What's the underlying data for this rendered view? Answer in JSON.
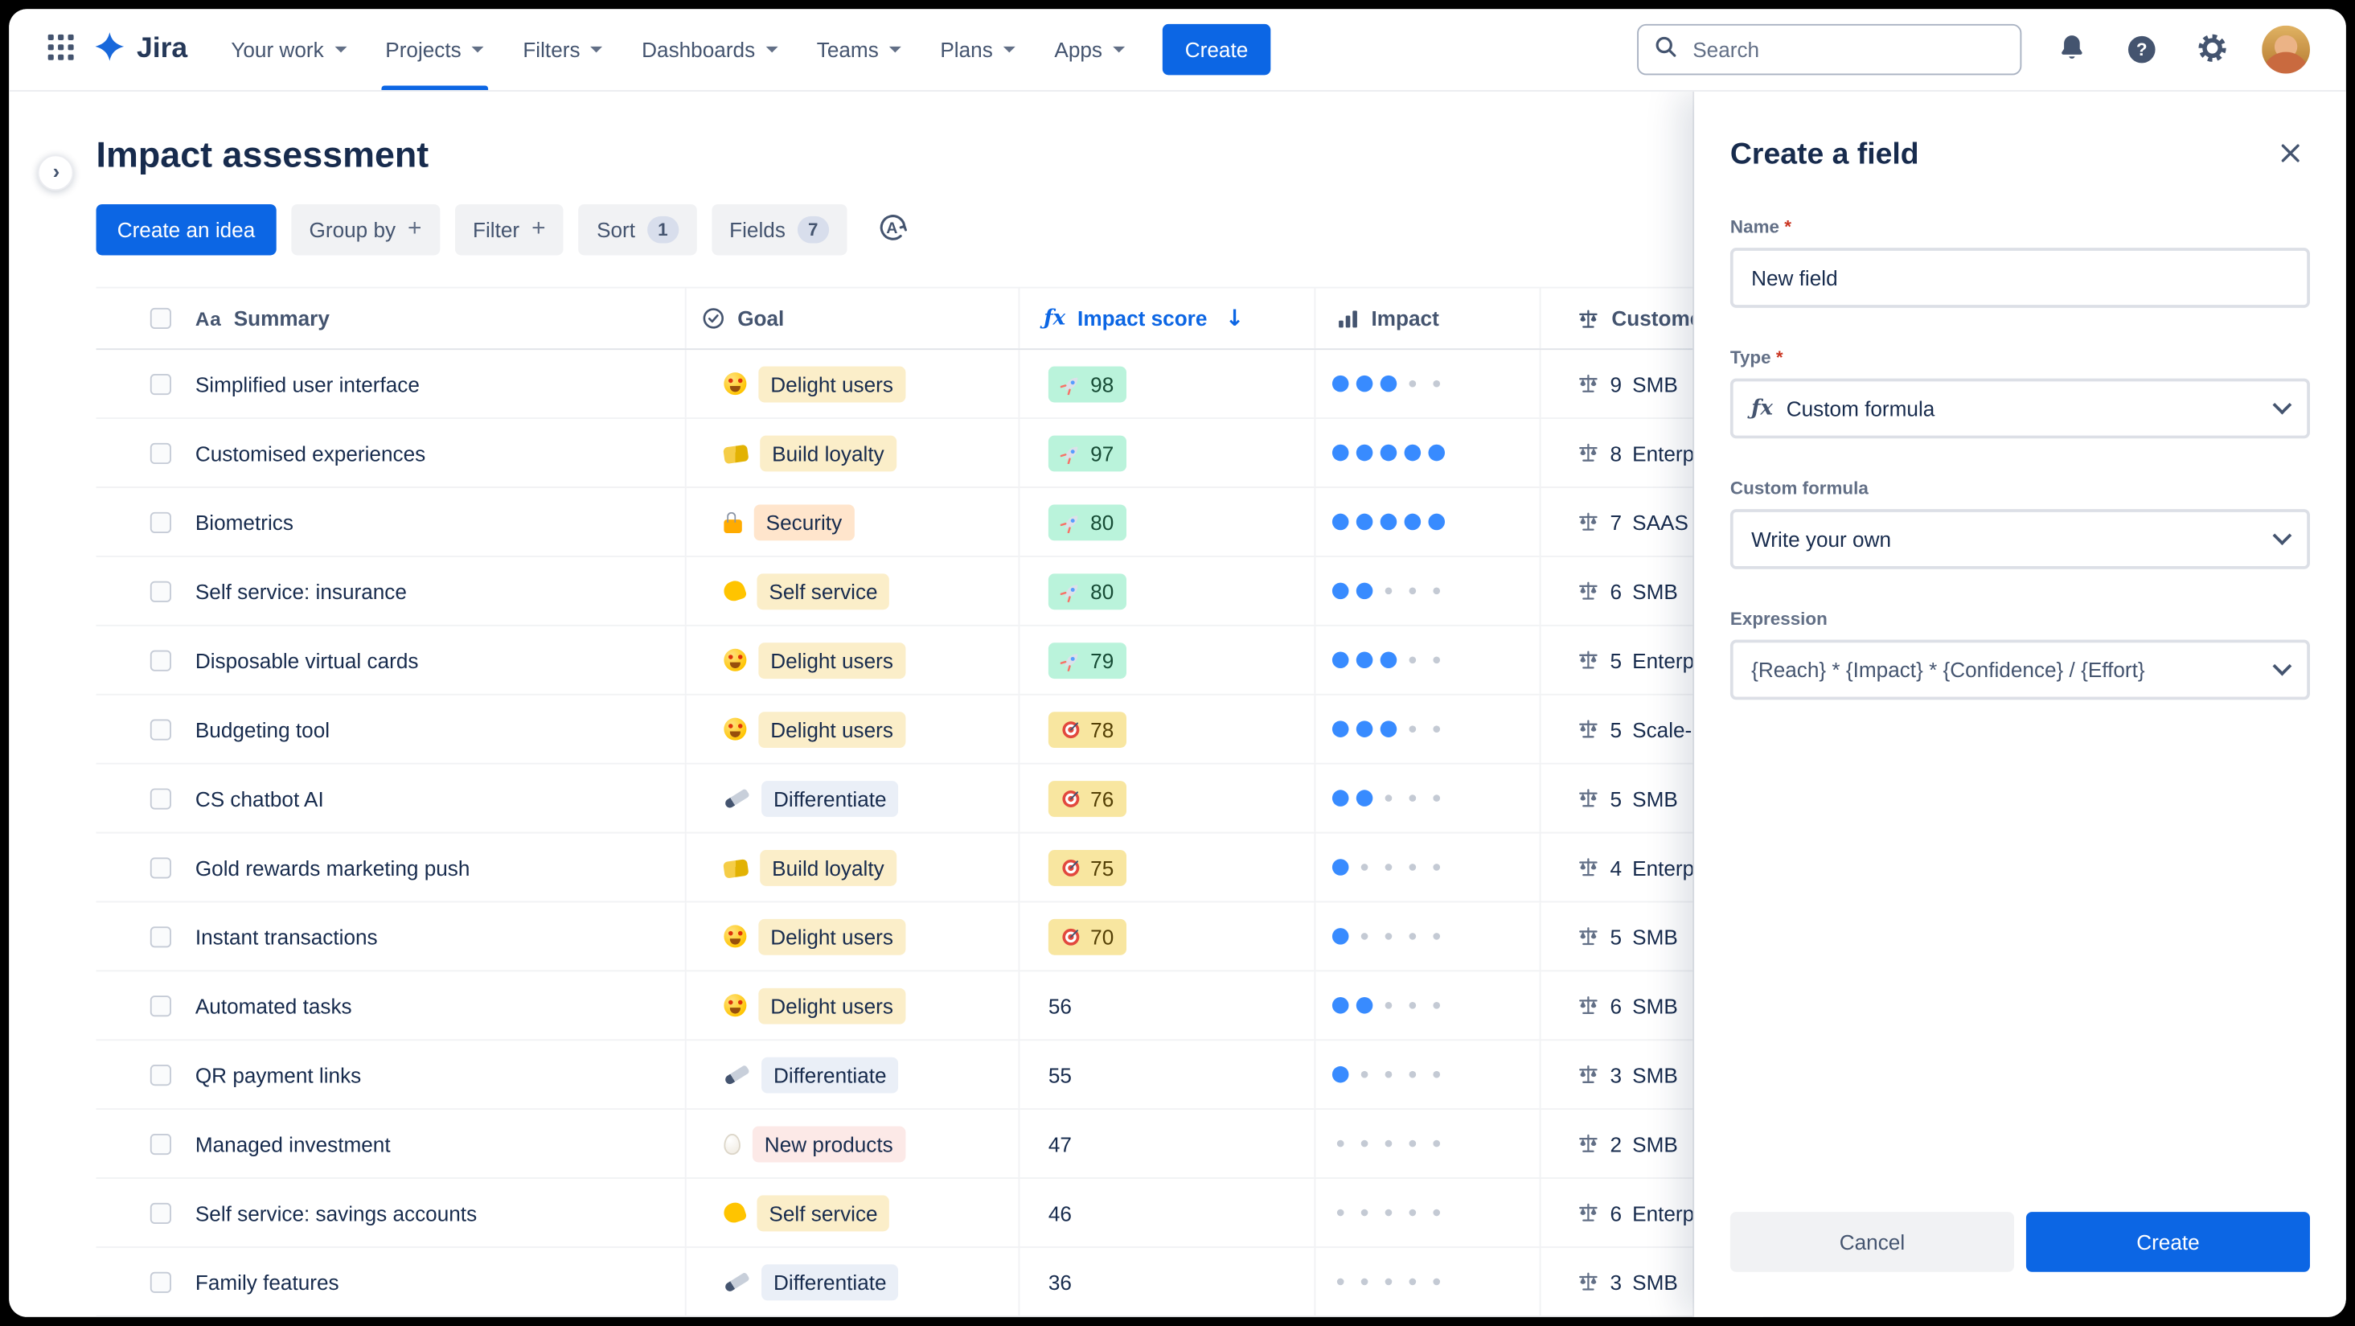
{
  "topnav": {
    "logo": "Jira",
    "items": [
      {
        "label": "Your work",
        "active": false
      },
      {
        "label": "Projects",
        "active": true
      },
      {
        "label": "Filters",
        "active": false
      },
      {
        "label": "Dashboards",
        "active": false
      },
      {
        "label": "Teams",
        "active": false
      },
      {
        "label": "Plans",
        "active": false
      },
      {
        "label": "Apps",
        "active": false
      }
    ],
    "create_button": "Create",
    "search": {
      "placeholder": "Search"
    }
  },
  "page": {
    "title": "Impact assessment"
  },
  "toolbar": {
    "create_idea_button": "Create an idea",
    "group_by_button": "Group by",
    "filter_button": "Filter",
    "sort_button": "Sort",
    "sort_badge": "1",
    "fields_button": "Fields",
    "fields_badge": "7"
  },
  "icons": {
    "summary_type": "Aa",
    "formula": "ƒx",
    "sort_desc": "↓",
    "help": "?"
  },
  "table": {
    "columns": [
      {
        "id": "summary",
        "label": "Summary"
      },
      {
        "id": "goal",
        "label": "Goal"
      },
      {
        "id": "impact_score",
        "label": "Impact score",
        "sorted": "desc"
      },
      {
        "id": "impact",
        "label": "Impact"
      },
      {
        "id": "customer_segment",
        "label": "Customer segment"
      }
    ],
    "impact_dots_total": 5,
    "rows": [
      {
        "summary": "Simplified user interface",
        "goal": "Delight users",
        "goal_icon": "heart-eyes",
        "goal_color": "yellow",
        "score": "98",
        "score_icon": "rocket",
        "score_style": "green",
        "impact": 3,
        "segment_value": "9",
        "segment": "SMB"
      },
      {
        "summary": "Customised experiences",
        "goal": "Build loyalty",
        "goal_icon": "handshake",
        "goal_color": "yellow",
        "score": "97",
        "score_icon": "rocket",
        "score_style": "green",
        "impact": 5,
        "segment_value": "8",
        "segment": "Enterprise"
      },
      {
        "summary": "Biometrics",
        "goal": "Security",
        "goal_icon": "lock",
        "goal_color": "orange",
        "score": "80",
        "score_icon": "rocket",
        "score_style": "green",
        "impact": 5,
        "segment_value": "7",
        "segment": "SAAS"
      },
      {
        "summary": "Self service: insurance",
        "goal": "Self service",
        "goal_icon": "muscle",
        "goal_color": "yellow",
        "score": "80",
        "score_icon": "rocket",
        "score_style": "green",
        "impact": 2,
        "segment_value": "6",
        "segment": "SMB"
      },
      {
        "summary": "Disposable virtual cards",
        "goal": "Delight users",
        "goal_icon": "heart-eyes",
        "goal_color": "yellow",
        "score": "79",
        "score_icon": "rocket",
        "score_style": "green",
        "impact": 3,
        "segment_value": "5",
        "segment": "Enterprise"
      },
      {
        "summary": "Budgeting tool",
        "goal": "Delight users",
        "goal_icon": "heart-eyes",
        "goal_color": "yellow",
        "score": "78",
        "score_icon": "target",
        "score_style": "yellow",
        "impact": 3,
        "segment_value": "5",
        "segment": "Scale-ups"
      },
      {
        "summary": "CS chatbot AI",
        "goal": "Differentiate",
        "goal_icon": "knife",
        "goal_color": "blue",
        "score": "76",
        "score_icon": "target",
        "score_style": "yellow",
        "impact": 2,
        "segment_value": "5",
        "segment": "SMB"
      },
      {
        "summary": "Gold rewards marketing push",
        "goal": "Build loyalty",
        "goal_icon": "handshake",
        "goal_color": "yellow",
        "score": "75",
        "score_icon": "target",
        "score_style": "yellow",
        "impact": 1,
        "segment_value": "4",
        "segment": "Enterprise"
      },
      {
        "summary": "Instant transactions",
        "goal": "Delight users",
        "goal_icon": "heart-eyes",
        "goal_color": "yellow",
        "score": "70",
        "score_icon": "target",
        "score_style": "yellow",
        "impact": 1,
        "segment_value": "5",
        "segment": "SMB"
      },
      {
        "summary": "Automated tasks",
        "goal": "Delight users",
        "goal_icon": "heart-eyes",
        "goal_color": "yellow",
        "score": "56",
        "score_icon": null,
        "score_style": "plain",
        "impact": 2,
        "segment_value": "6",
        "segment": "SMB"
      },
      {
        "summary": "QR payment links",
        "goal": "Differentiate",
        "goal_icon": "knife",
        "goal_color": "blue",
        "score": "55",
        "score_icon": null,
        "score_style": "plain",
        "impact": 1,
        "segment_value": "3",
        "segment": "SMB"
      },
      {
        "summary": "Managed investment",
        "goal": "New products",
        "goal_icon": "egg",
        "goal_color": "pink",
        "score": "47",
        "score_icon": null,
        "score_style": "plain",
        "impact": 0,
        "segment_value": "2",
        "segment": "SMB"
      },
      {
        "summary": "Self service: savings accounts",
        "goal": "Self service",
        "goal_icon": "muscle",
        "goal_color": "yellow",
        "score": "46",
        "score_icon": null,
        "score_style": "plain",
        "impact": 0,
        "segment_value": "6",
        "segment": "Enterprise"
      },
      {
        "summary": "Family features",
        "goal": "Differentiate",
        "goal_icon": "knife",
        "goal_color": "blue",
        "score": "36",
        "score_icon": null,
        "score_style": "plain",
        "impact": 0,
        "segment_value": "3",
        "segment": "SMB"
      }
    ]
  },
  "panel": {
    "title": "Create a field",
    "fields": {
      "name": {
        "label": "Name",
        "required": true,
        "value": "New field"
      },
      "type": {
        "label": "Type",
        "required": true,
        "value": "Custom formula"
      },
      "custom_formula": {
        "label": "Custom formula",
        "value": "Write your own"
      },
      "expression": {
        "label": "Expression",
        "value": "{Reach} * {Impact} * {Confidence} / {Effort}"
      }
    },
    "cancel_button": "Cancel",
    "create_button": "Create"
  }
}
